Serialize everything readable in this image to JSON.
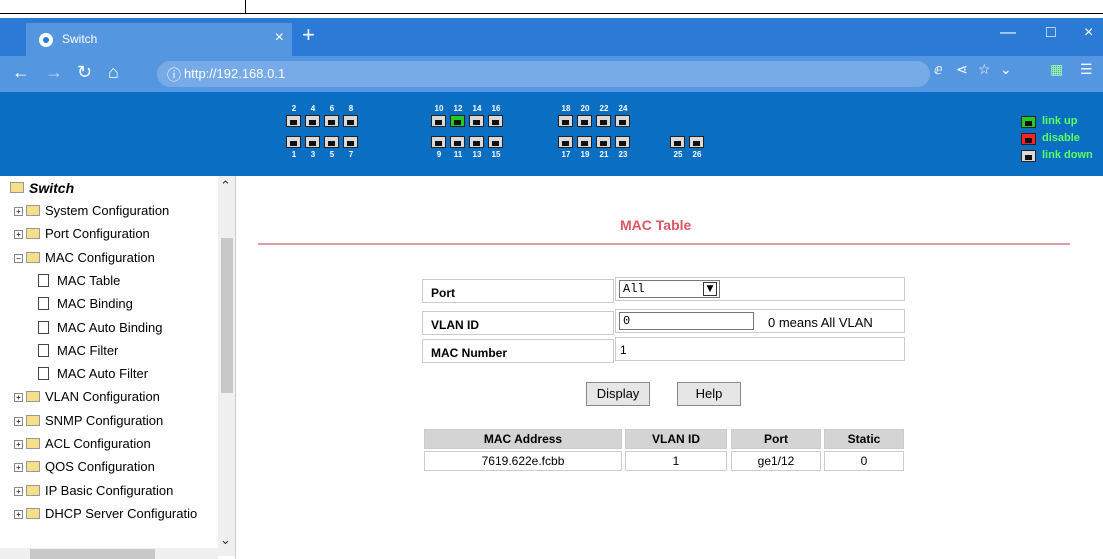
{
  "browser": {
    "tab_title": "Switch",
    "tab_close": "×",
    "new_tab": "+",
    "url": "http://192.168.0.1",
    "controls": {
      "minimize": "—",
      "maximize": "□",
      "close": "×"
    }
  },
  "banner": {
    "top_port_numbers": [
      "2",
      "4",
      "6",
      "8",
      "10",
      "12",
      "14",
      "16",
      "18",
      "20",
      "22",
      "24"
    ],
    "bottom_port_numbers": [
      "1",
      "3",
      "5",
      "7",
      "9",
      "11",
      "13",
      "15",
      "17",
      "19",
      "21",
      "23",
      "25",
      "26"
    ],
    "link_up_port": "12",
    "legend": {
      "link_up": "link up",
      "disable": "disable",
      "link_down": "link down"
    },
    "colors": {
      "link_up": "#22cc22",
      "disable": "#ff2222",
      "link_down": "#d9d9d9"
    }
  },
  "sidebar": {
    "root": "Switch",
    "items": [
      {
        "label": "System Configuration",
        "type": "folder",
        "expanded": false
      },
      {
        "label": "Port Configuration",
        "type": "folder",
        "expanded": false
      },
      {
        "label": "MAC Configuration",
        "type": "folder",
        "expanded": true
      },
      {
        "label": "MAC Table",
        "type": "page"
      },
      {
        "label": "MAC Binding",
        "type": "page"
      },
      {
        "label": "MAC Auto Binding",
        "type": "page"
      },
      {
        "label": "MAC Filter",
        "type": "page"
      },
      {
        "label": "MAC Auto Filter",
        "type": "page"
      },
      {
        "label": "VLAN Configuration",
        "type": "folder",
        "expanded": false
      },
      {
        "label": "SNMP Configuration",
        "type": "folder",
        "expanded": false
      },
      {
        "label": "ACL Configuration",
        "type": "folder",
        "expanded": false
      },
      {
        "label": "QOS Configuration",
        "type": "folder",
        "expanded": false
      },
      {
        "label": "IP Basic Configuration",
        "type": "folder",
        "expanded": false
      },
      {
        "label": "DHCP Server Configuratio",
        "type": "folder",
        "expanded": false
      }
    ]
  },
  "main": {
    "title": "MAC Table",
    "form": {
      "port_label": "Port",
      "port_value": "All",
      "vlan_label": "VLAN ID",
      "vlan_value": "0",
      "vlan_hint": "0 means All VLAN",
      "mac_number_label": "MAC Number",
      "mac_number_value": "1"
    },
    "buttons": {
      "display": "Display",
      "help": "Help"
    },
    "table": {
      "headers": [
        "MAC Address",
        "VLAN ID",
        "Port",
        "Static"
      ],
      "rows": [
        [
          "7619.622e.fcbb",
          "1",
          "ge1/12",
          "0"
        ]
      ]
    }
  }
}
